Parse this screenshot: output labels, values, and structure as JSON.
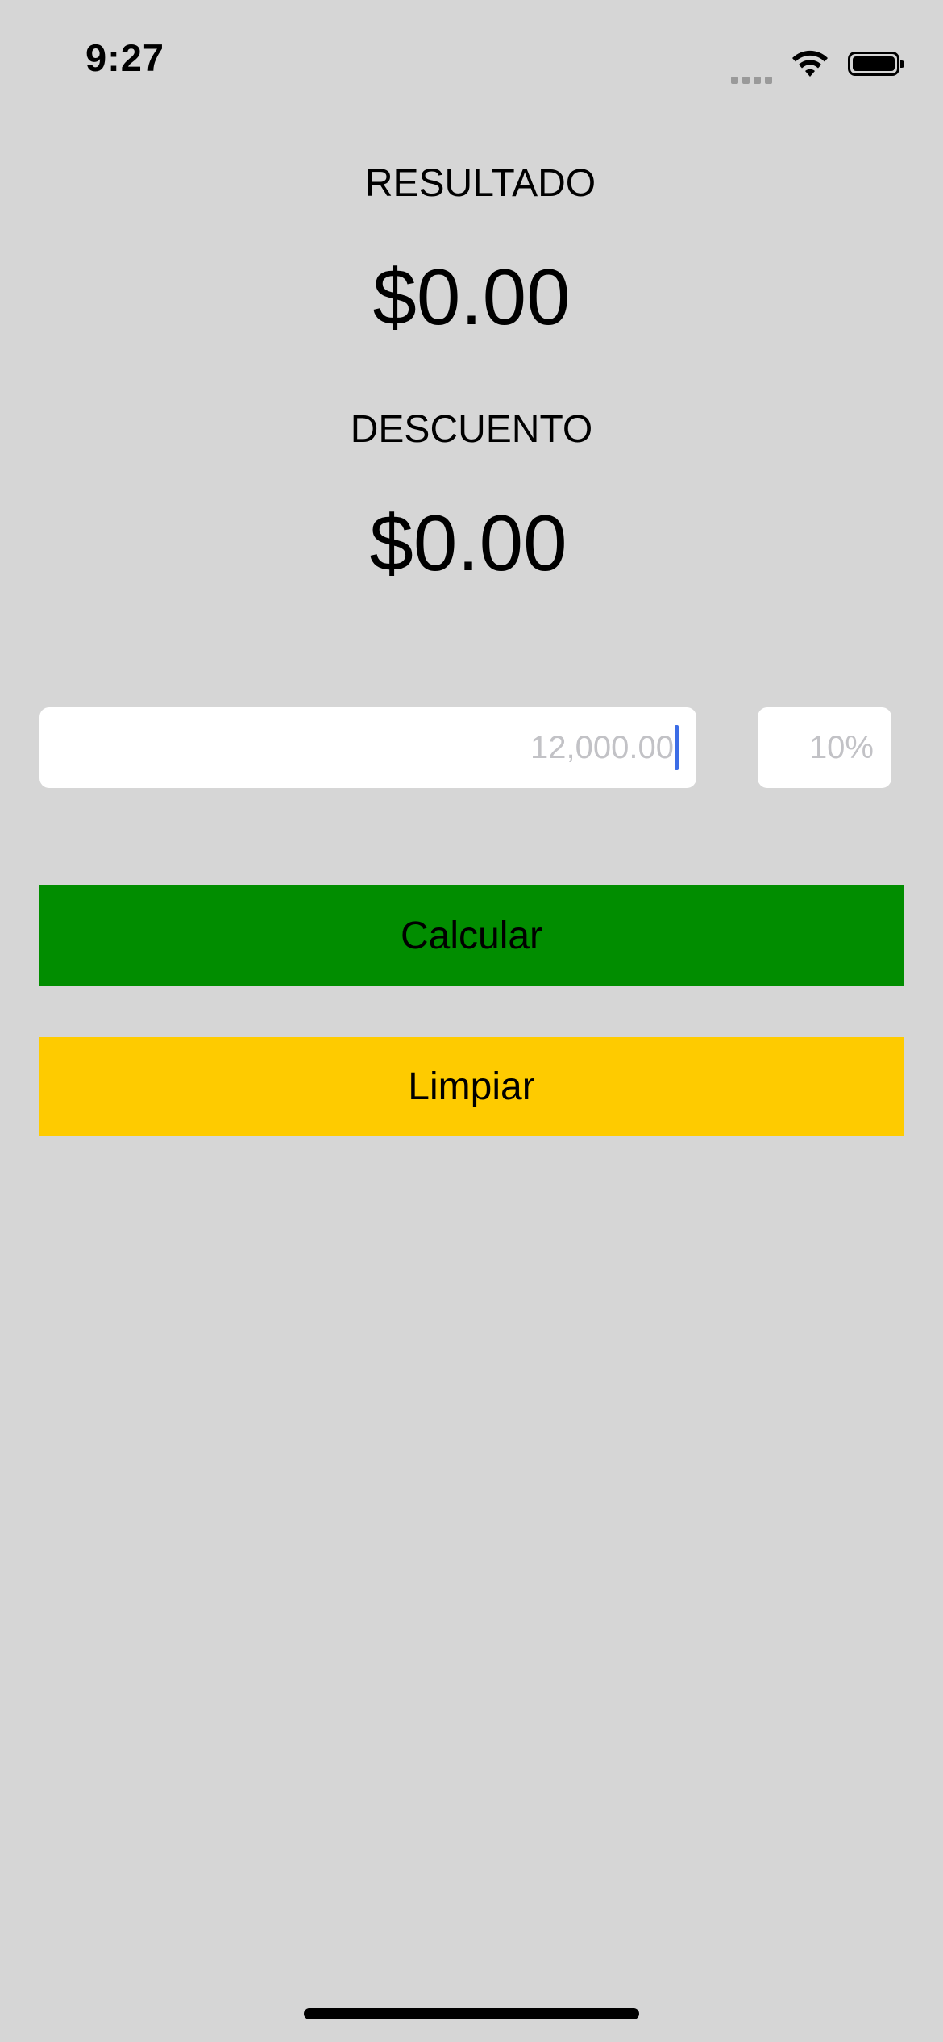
{
  "status_bar": {
    "time": "9:27",
    "icons": [
      "cellular-signal-icon",
      "wifi-icon",
      "battery-icon"
    ]
  },
  "result": {
    "label": "RESULTADO",
    "value": "$0.00"
  },
  "discount": {
    "label": "DESCUENTO",
    "value": "$0.00"
  },
  "inputs": {
    "amount_placeholder": "12,000.00",
    "amount_value": "",
    "percent_placeholder": "10%",
    "percent_value": ""
  },
  "buttons": {
    "calcular_label": "Calcular",
    "limpiar_label": "Limpiar"
  },
  "colors": {
    "background": "#d6d6d6",
    "calcular": "#018d00",
    "limpiar": "#fecb00",
    "cursor": "#3c6de6"
  }
}
